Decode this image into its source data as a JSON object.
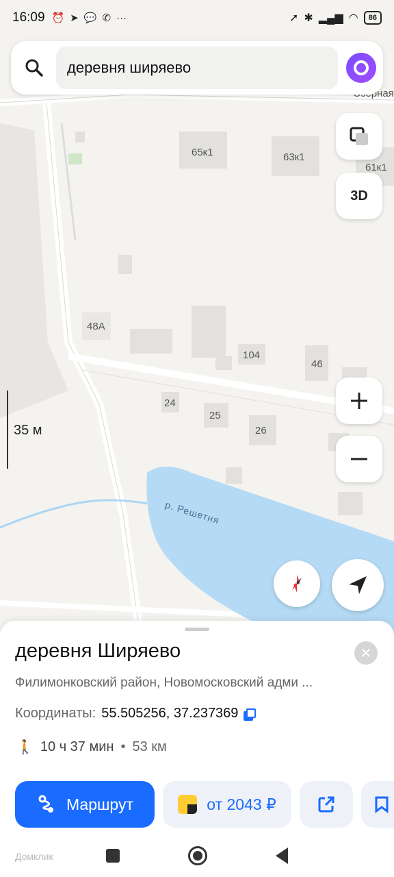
{
  "status_bar": {
    "time": "16:09",
    "battery": "86"
  },
  "search": {
    "query": "деревня ширяево"
  },
  "map": {
    "street_label": "Озерная",
    "house_labels": [
      "65к1",
      "63к1",
      "61к1",
      "48А",
      "104",
      "46",
      "24",
      "25",
      "26"
    ],
    "river_label": "р. Решетня",
    "button_3d": "3D",
    "scale": "35 м"
  },
  "place": {
    "title": "деревня Ширяево",
    "subtitle": "Филимонковский район, Новомосковский адми ...",
    "coords_label": "Координаты:",
    "coords_value": "55.505256, 37.237369",
    "walk_time": "10 ч 37 мин",
    "distance": "53 км",
    "route_label": "Маршрут",
    "taxi_label": "от 2043 ₽"
  },
  "watermark": "Домклик",
  "colors": {
    "accent": "#1a6bff",
    "water": "#b5daf5",
    "alice": "#8a4dff"
  }
}
